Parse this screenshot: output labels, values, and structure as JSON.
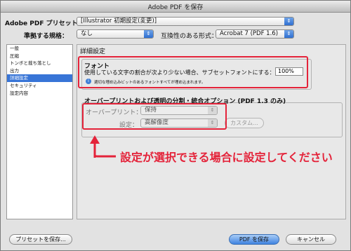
{
  "window": {
    "title": "Adobe PDF を保存"
  },
  "top": {
    "preset_label": "Adobe PDF プリセット：",
    "preset_value": "[Illustrator 初期設定(変更)]",
    "standard_label": "準拠する規格：",
    "standard_value": "なし",
    "compat_label": "互換性のある形式：",
    "compat_value": "Acrobat 7 (PDF 1.6)"
  },
  "sidebar": {
    "items": [
      "一般",
      "圧縮",
      "トンボと裁ち落とし",
      "出力",
      "詳細設定",
      "セキュリティ",
      "設定内容"
    ],
    "selected_index": 4
  },
  "panel": {
    "title": "詳細設定",
    "font_group": {
      "title": "フォント",
      "subset_label": "使用している文字の割合が次より少ない場合、サブセットフォントにする：",
      "subset_value": "100%",
      "info_text": "適切な埋め込みビットのあるフォントすべてが埋め込まれます。"
    },
    "overprint_group": {
      "title": "オーバープリントおよび透明の分割・統合オプション (PDF 1.3 のみ)",
      "overprint_label": "オーバープリント：",
      "overprint_value": "保持",
      "preset_label": "設定：",
      "preset_value": "高解像度",
      "custom_button": "カスタム..."
    }
  },
  "annotation": {
    "text": "設定が選択できる場合に設定してください",
    "color": "#e4233a"
  },
  "buttons": {
    "save_preset": "プリセットを保存...",
    "save_pdf": "PDF を保存",
    "cancel": "キャンセル"
  },
  "icons": {
    "select_arrow": "chevron-updown-icon",
    "info": "info-icon",
    "annot_arrow": "bent-arrow-icon"
  }
}
